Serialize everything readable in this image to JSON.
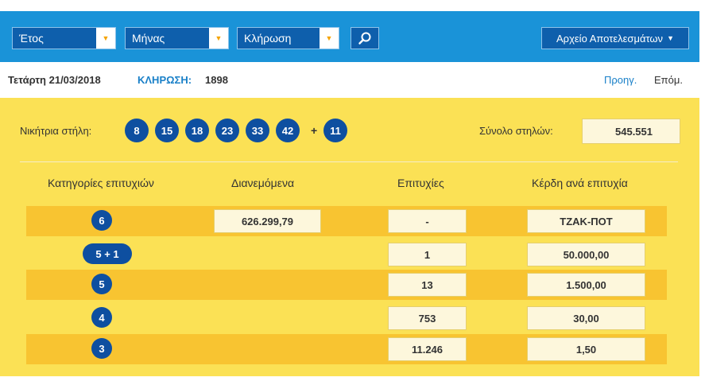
{
  "toolbar": {
    "year_label": "Έτος",
    "month_label": "Μήνας",
    "draw_label": "Κλήρωση",
    "archive_label": "Αρχείο Αποτελεσμάτων",
    "icons": {
      "dropdown": "caret-down-icon",
      "search": "search-icon"
    },
    "colors": {
      "bar": "#1a93d8",
      "control": "#0e5fac",
      "caret": "#f5a300"
    }
  },
  "info": {
    "date": "Τετάρτη 21/03/2018",
    "draw_label": "ΚΛΗΡΩΣΗ:",
    "draw_number": "1898",
    "prev_label": "Προηγ.",
    "next_label": "Επόμ."
  },
  "results": {
    "winning_label": "Νικήτρια στήλη:",
    "numbers": [
      "8",
      "15",
      "18",
      "23",
      "33",
      "42"
    ],
    "plus_sign": "+",
    "bonus": "11",
    "total_label": "Σύνολο στηλών:",
    "total_value": "545.551",
    "colors": {
      "panel": "#fbe155",
      "row_alt": "#f8c431",
      "ball": "#0e4fa0"
    }
  },
  "table": {
    "headers": [
      "Κατηγορίες επιτυχιών",
      "Διανεμόμενα",
      "Επιτυχίες",
      "Κέρδη ανά επιτυχία"
    ],
    "rows": [
      {
        "category": "6",
        "distributed": "626.299,79",
        "winners": "-",
        "prize": "ΤΖΑΚ-ΠΟΤ"
      },
      {
        "category": "5 + 1",
        "distributed": "",
        "winners": "1",
        "prize": "50.000,00"
      },
      {
        "category": "5",
        "distributed": "",
        "winners": "13",
        "prize": "1.500,00"
      },
      {
        "category": "4",
        "distributed": "",
        "winners": "753",
        "prize": "30,00"
      },
      {
        "category": "3",
        "distributed": "",
        "winners": "11.246",
        "prize": "1,50"
      }
    ]
  }
}
